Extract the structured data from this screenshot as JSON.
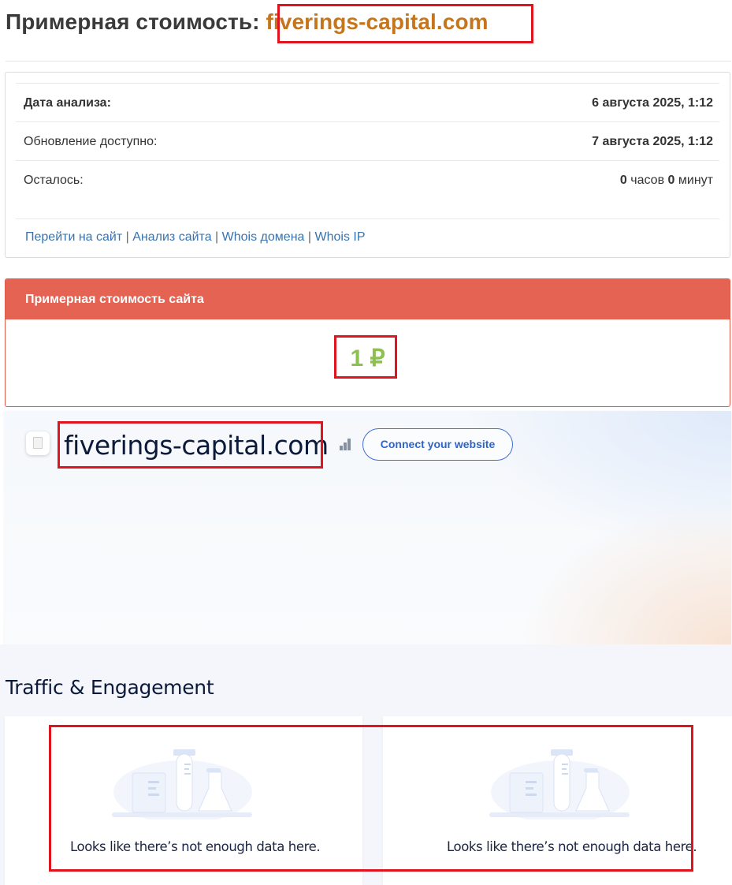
{
  "header": {
    "title_prefix": "Примерная стоимость:",
    "domain": "fiverings-capital.com"
  },
  "analysis": {
    "rows": [
      {
        "label": "Дата анализа:",
        "value": "6 августа 2025, 1:12"
      },
      {
        "label": "Обновление доступно:",
        "value": "7 августа 2025, 1:12"
      }
    ],
    "remaining": {
      "label": "Осталось:",
      "hours": "0",
      "hours_unit": "часов",
      "minutes": "0",
      "minutes_unit": "минут"
    },
    "links": [
      "Перейти на сайт",
      "Анализ сайта",
      "Whois домена",
      "Whois IP"
    ],
    "separator": "|"
  },
  "valuation": {
    "heading": "Примерная стоимость сайта",
    "amount": "1 ₽"
  },
  "similarweb": {
    "domain": "fiverings-capital.com",
    "icons": {
      "favicon": "document-icon",
      "rank": "bar-chart-icon"
    },
    "connect_button": "Connect your website",
    "section_title": "Traffic & Engagement",
    "empty_messages": [
      "Looks like there’s not enough data here.",
      "Looks like there’s not enough data here."
    ]
  },
  "colors": {
    "domain_accent": "#c5761c",
    "panel_header": "#e46352",
    "amount": "#8cc152",
    "link": "#3873b0",
    "highlight_box": "#e0141e"
  }
}
